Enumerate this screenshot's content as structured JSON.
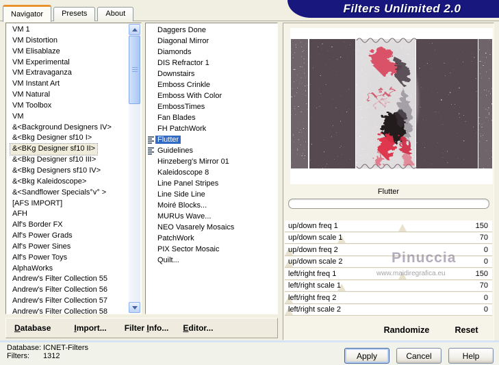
{
  "title_banner": {
    "text": "Filters Unlimited 2.0"
  },
  "tabs": [
    {
      "label": "Navigator",
      "active": true
    },
    {
      "label": "Presets",
      "active": false
    },
    {
      "label": "About",
      "active": false
    }
  ],
  "category_list": {
    "selected": "&<BKg Designer sf10 II>",
    "items": [
      "VM 1",
      "VM Distortion",
      "VM Elisablaze",
      "VM Experimental",
      "VM Extravaganza",
      "VM Instant Art",
      "VM Natural",
      "VM Toolbox",
      "VM",
      "&<Background Designers IV>",
      "&<Bkg Designer sf10 I>",
      "&<BKg Designer sf10 II>",
      "&<Bkg Designer sf10 III>",
      "&<Bkg Designers sf10 IV>",
      "&<Bkg Kaleidoscope>",
      "&<Sandflower Specials°v° >",
      "[AFS IMPORT]",
      "AFH",
      "Alf's Border FX",
      "Alf's Power Grads",
      "Alf's Power Sines",
      "Alf's Power Toys",
      "AlphaWorks",
      "Andrew's Filter Collection 55",
      "Andrew's Filter Collection 56",
      "Andrew's Filter Collection 57",
      "Andrew's Filter Collection 58"
    ]
  },
  "filter_list": {
    "selected": "Flutter",
    "items": [
      {
        "label": "Daggers Done",
        "marked": false
      },
      {
        "label": "Diagonal Mirror",
        "marked": false
      },
      {
        "label": "Diamonds",
        "marked": false
      },
      {
        "label": "DIS Refractor 1",
        "marked": false
      },
      {
        "label": "Downstairs",
        "marked": false
      },
      {
        "label": "Emboss Crinkle",
        "marked": false
      },
      {
        "label": "Emboss With Color",
        "marked": false
      },
      {
        "label": "EmbossTimes",
        "marked": false
      },
      {
        "label": "Fan Blades",
        "marked": false
      },
      {
        "label": "FH PatchWork",
        "marked": false
      },
      {
        "label": "Flutter",
        "marked": true
      },
      {
        "label": "Guidelines",
        "marked": true
      },
      {
        "label": "Hinzeberg's Mirror 01",
        "marked": false
      },
      {
        "label": "Kaleidoscope 8",
        "marked": false
      },
      {
        "label": "Line Panel Stripes",
        "marked": false
      },
      {
        "label": "Line Side Line",
        "marked": false
      },
      {
        "label": "Moiré Blocks...",
        "marked": false
      },
      {
        "label": "MURUs Wave...",
        "marked": false
      },
      {
        "label": "NEO Vasarely Mosaics",
        "marked": false
      },
      {
        "label": "PatchWork",
        "marked": false
      },
      {
        "label": "PIX Sector Mosaic",
        "marked": false
      },
      {
        "label": "Quilt...",
        "marked": false
      }
    ]
  },
  "preview": {
    "filter_name": "Flutter"
  },
  "parameters": [
    {
      "label": "up/down freq 1",
      "value": 150
    },
    {
      "label": "up/down scale 1",
      "value": 70
    },
    {
      "label": "up/down freq 2",
      "value": 0
    },
    {
      "label": "up/down scale 2",
      "value": 0
    },
    {
      "label": "left/right freq 1",
      "value": 150
    },
    {
      "label": "left/right scale 1",
      "value": 70
    },
    {
      "label": "left/right freq 2",
      "value": 0
    },
    {
      "label": "left/right scale 2",
      "value": 0
    }
  ],
  "watermark": {
    "line1": "Pinuccia",
    "line2": "www.maidiregrafica.eu"
  },
  "panel_actions": {
    "randomize": "Randomize",
    "reset": "Reset"
  },
  "toolbar_items": [
    {
      "name": "database",
      "pre": "",
      "accel": "D",
      "rest": "atabase"
    },
    {
      "name": "import",
      "pre": "",
      "accel": "I",
      "rest": "mport..."
    },
    {
      "name": "filter-info",
      "pre": "Filter ",
      "accel": "I",
      "rest": "nfo..."
    },
    {
      "name": "editor",
      "pre": "",
      "accel": "E",
      "rest": "ditor..."
    }
  ],
  "status": {
    "database_label": "Database:",
    "database_value": "ICNET-Filters",
    "filters_label": "Filters:",
    "filters_value": "1312"
  },
  "dialog_buttons": [
    {
      "name": "apply",
      "label": "Apply",
      "default": true
    },
    {
      "name": "cancel",
      "label": "Cancel",
      "default": false
    },
    {
      "name": "help",
      "label": "Help",
      "default": false
    }
  ],
  "colors": {
    "selection_blue": "#316ac5",
    "banner_navy": "#17177e",
    "tab_accent_orange": "#e8932c",
    "preview_noise": "#57494f",
    "motif_red": "#d84058"
  }
}
